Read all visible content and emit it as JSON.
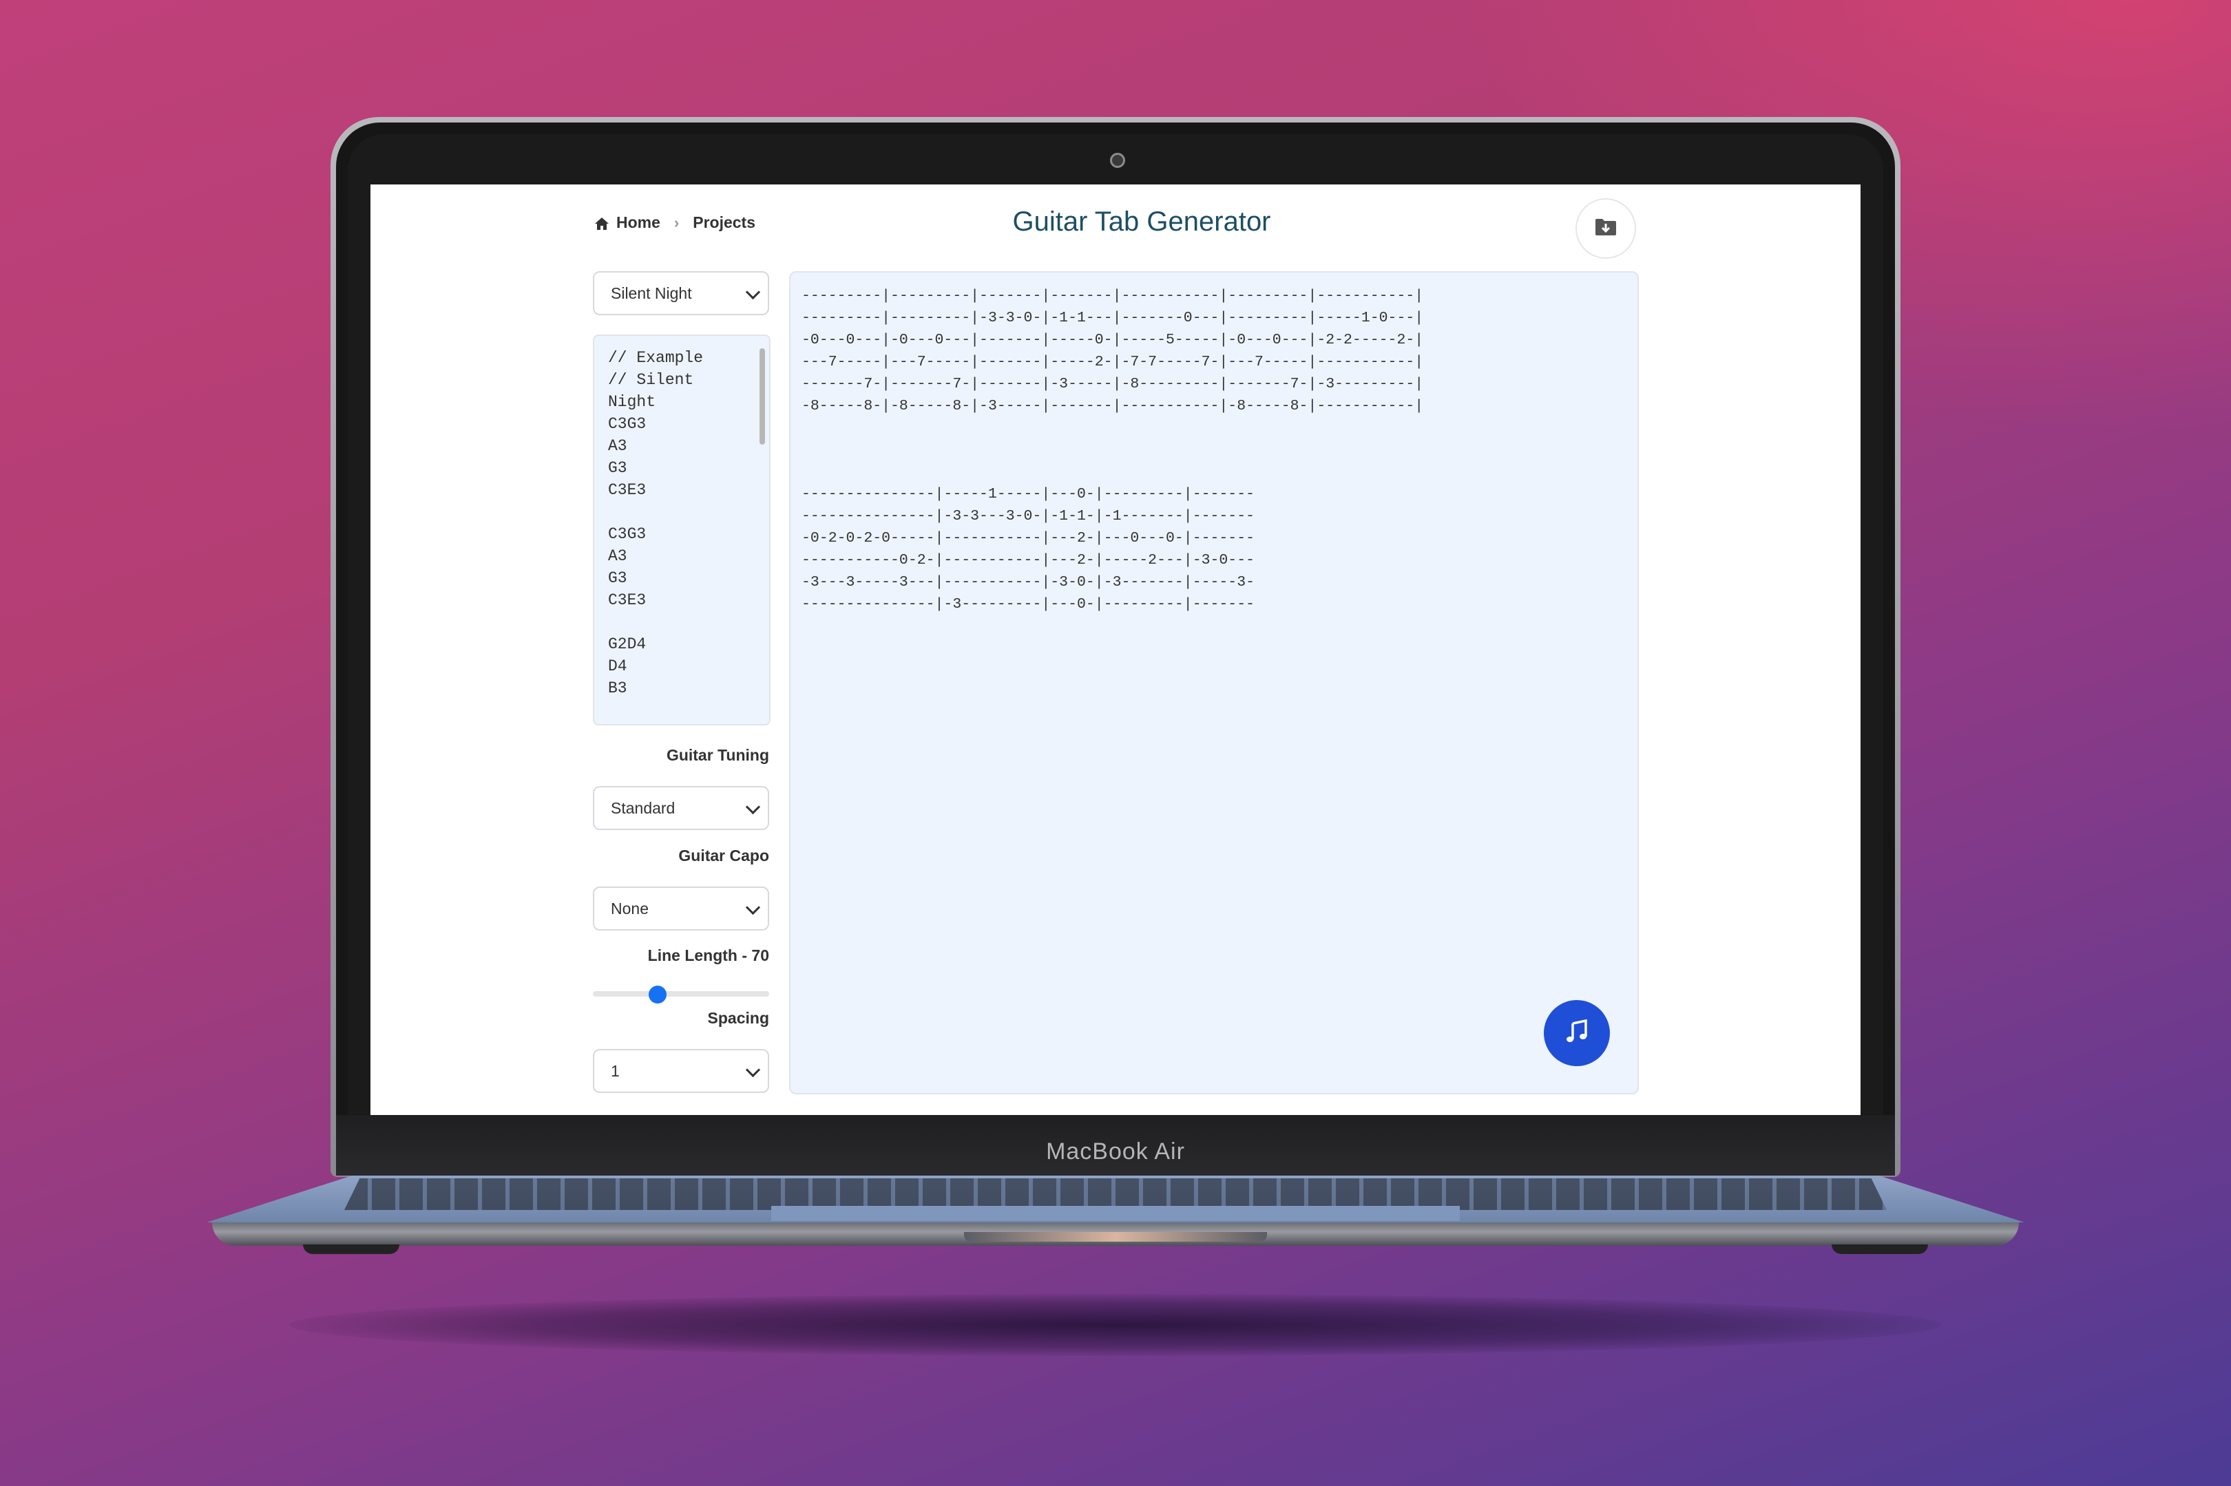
{
  "laptop": {
    "model_label": "MacBook Air"
  },
  "breadcrumb": [
    {
      "label": "Home",
      "icon": "home-icon"
    },
    {
      "label": "Projects"
    }
  ],
  "header": {
    "title": "Guitar Tab Generator",
    "save_icon": "folder-download-icon"
  },
  "song_select": {
    "value": "Silent Night"
  },
  "editor": {
    "text": "// Example\n// Silent\nNight\nC3G3\nA3\nG3\nC3E3\n\nC3G3\nA3\nG3\nC3E3\n\nG2D4\nD4\nB3"
  },
  "settings": {
    "tuning_label": "Guitar Tuning",
    "tuning_value": "Standard",
    "capo_label": "Guitar Capo",
    "capo_value": "None",
    "line_length_label": "Line Length - 70",
    "line_length_fraction": 0.35,
    "spacing_label": "Spacing",
    "spacing_value": "1"
  },
  "output": {
    "text": "---------|---------|-------|-------|-----------|---------|-----------|\n---------|---------|-3-3-0-|-1-1---|-------0---|---------|-----1-0---|\n-0---0---|-0---0---|-------|-----0-|-----5-----|-0---0---|-2-2-----2-|\n---7-----|---7-----|-------|-----2-|-7-7-----7-|---7-----|-----------|\n-------7-|-------7-|-------|-3-----|-8---------|-------7-|-3---------|\n-8-----8-|-8-----8-|-3-----|-------|-----------|-8-----8-|-----------|\n\n\n\n---------------|-----1-----|---0-|---------|-------\n---------------|-3-3---3-0-|-1-1-|-1-------|-------\n-0-2-0-2-0-----|-----------|---2-|---0---0-|-------\n-----------0-2-|-----------|---2-|-----2---|-3-0---\n-3---3-----3---|-----------|-3-0-|-3-------|-----3-\n---------------|-3---------|---0-|---------|-------"
  },
  "play_button": {
    "icon": "music-note-icon"
  },
  "colors": {
    "accent": "#1f4fd6",
    "slider": "#1672f3",
    "title": "#1d4e63",
    "panel": "#eef4fe"
  }
}
